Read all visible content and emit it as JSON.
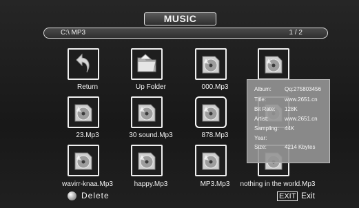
{
  "header": {
    "title": "MUSIC"
  },
  "path_bar": {
    "path": "C:\\ MP3",
    "page": "1 / 2"
  },
  "grid": {
    "items": [
      {
        "label": "Return",
        "icon": "return-arrow-icon"
      },
      {
        "label": "Up Folder",
        "icon": "folder-icon"
      },
      {
        "label": "000.Mp3",
        "icon": "music-file-icon"
      },
      {
        "label": "",
        "icon": "music-file-icon"
      },
      {
        "label": "23.Mp3",
        "icon": "music-file-icon"
      },
      {
        "label": "30 sound.Mp3",
        "icon": "music-file-icon"
      },
      {
        "label": "878.Mp3",
        "icon": "music-file-icon",
        "selected": true
      },
      {
        "label": "",
        "icon": "music-file-icon"
      },
      {
        "label": "wavirr-knaa.Mp3",
        "icon": "music-file-icon"
      },
      {
        "label": "happy.Mp3",
        "icon": "music-file-icon"
      },
      {
        "label": "MP3.Mp3",
        "icon": "music-file-icon"
      },
      {
        "label": "nothing in the world.Mp3",
        "icon": "music-file-icon"
      }
    ]
  },
  "info_panel": {
    "album_label": "Album:",
    "album_value": "Qq:275803456",
    "title_label": "Title:",
    "title_value": "www.2651.cn",
    "bitrate_label": "Bit Rate:",
    "bitrate_value": "128K",
    "artist_label": "Artist:",
    "artist_value": "www.2651.cn",
    "sampling_label": "Sampling:",
    "sampling_value": "44K",
    "year_label": "Year:",
    "year_value": "",
    "size_label": "Size:",
    "size_value": "4214 Kbytes"
  },
  "footer": {
    "delete_label": "Delete",
    "exit_key": "EXIT",
    "exit_label": "Exit"
  },
  "colors": {
    "background": "#1b1b1b",
    "text": "#f2f2f2",
    "panel": "#969696",
    "border": "#f0f0f0"
  }
}
